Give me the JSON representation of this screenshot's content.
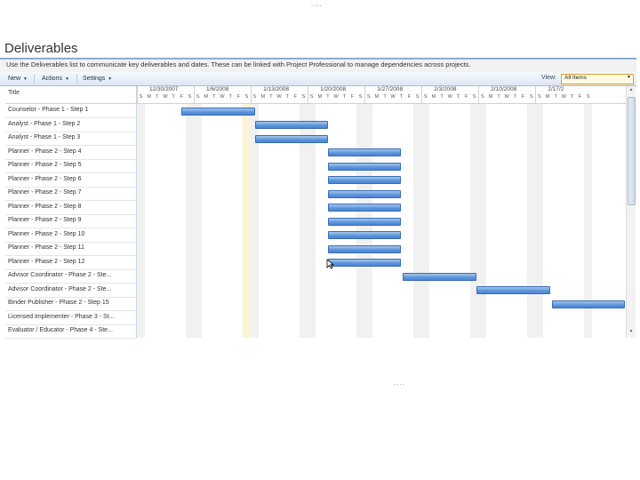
{
  "header": {
    "top_dots": "....",
    "title": "Deliverables",
    "description": "Use the Deliverables list to communicate key deliverables and dates. These can be linked with Project Professional to manage dependencies across projects."
  },
  "toolbar": {
    "new_label": "New",
    "actions_label": "Actions",
    "settings_label": "Settings",
    "view_label": "View:",
    "view_value": "All Items"
  },
  "grid": {
    "title_header": "Title",
    "weeks": [
      "12/30/2007",
      "1/6/2008",
      "1/13/2008",
      "1/20/2008",
      "1/27/2008",
      "2/3/2008",
      "2/10/2008",
      "2/17/2"
    ],
    "day_letters": [
      "S",
      "M",
      "T",
      "W",
      "T",
      "F",
      "S"
    ],
    "rows": [
      "Counselor - Phase 1 - Step 1",
      "Analyst - Phase 1 - Step 2",
      "Analyst - Phase 1 - Step 3",
      "Planner - Phase 2 - Step 4",
      "Planner - Phase 2 - Step 5",
      "Planner - Phase 2 - Step 6",
      "Planner - Phase 2 - Step 7",
      "Planner - Phase 2 - Step 8",
      "Planner - Phase 2 - Step 9",
      "Planner - Phase 2 - Step 10",
      "Planner - Phase 2 - Step 11",
      "Planner - Phase 2 - Step 12",
      "Advisor Coordinator - Phase 2 - Ste...",
      "Advisor Coordinator - Phase 2 - Ste...",
      "Binder Publisher - Phase 2 - Step 15",
      "Licensed Implementer - Phase 3 - St...",
      "Evaluator / Educator - Phase 4 - Ste..."
    ]
  },
  "footer": {
    "bottom_dots": "...."
  },
  "colors": {
    "bar_fill": "#5b94db",
    "bar_border": "#3a6cb0",
    "title_rule": "#6b8fb7",
    "view_select_bg": "#fffbe0"
  },
  "icons": [
    "chevron-down-icon",
    "scroll-up-icon",
    "scroll-down-icon",
    "mouse-cursor-icon"
  ]
}
